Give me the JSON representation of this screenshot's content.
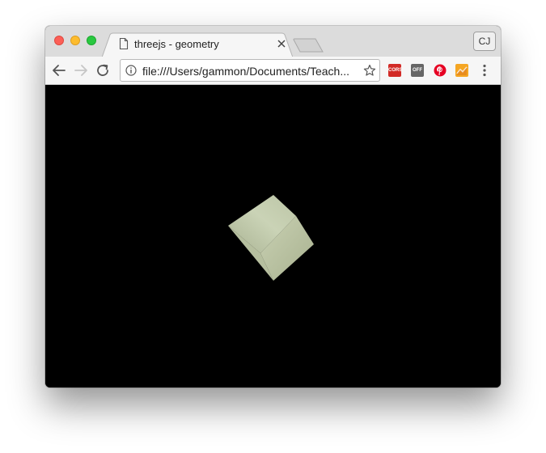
{
  "window": {
    "traffic_lights": [
      "close",
      "minimize",
      "maximize"
    ],
    "colors": {
      "close": "#fc5f57",
      "minimize": "#fdbc2e",
      "maximize": "#29c840"
    }
  },
  "tab": {
    "title": "threejs - geometry",
    "icon": "document-icon",
    "close_icon": "close-icon"
  },
  "new_tab": {
    "icon": "new-tab-icon"
  },
  "profile": {
    "initials": "CJ"
  },
  "toolbar": {
    "back_icon": "arrow-left-icon",
    "forward_icon": "arrow-right-icon",
    "reload_icon": "reload-icon",
    "address": {
      "url": "file:///Users/gammon/Documents/Teach...",
      "info_icon": "info-icon",
      "bookmark_icon": "star-icon"
    },
    "extensions": [
      {
        "name": "cors-extension-icon",
        "label": "CORS",
        "color": "#d22a26"
      },
      {
        "name": "off-extension-icon",
        "label": "OFF",
        "color": "#666666"
      },
      {
        "name": "pinterest-icon",
        "color": "#e60023"
      },
      {
        "name": "chart-extension-icon",
        "color": "#f5a623"
      }
    ],
    "menu_icon": "more-vertical-icon"
  },
  "canvas": {
    "background": "#000000",
    "object": "rotating-cube",
    "cube_colors": [
      "#c8d1b1",
      "#bfc8a7",
      "#aab493"
    ]
  }
}
